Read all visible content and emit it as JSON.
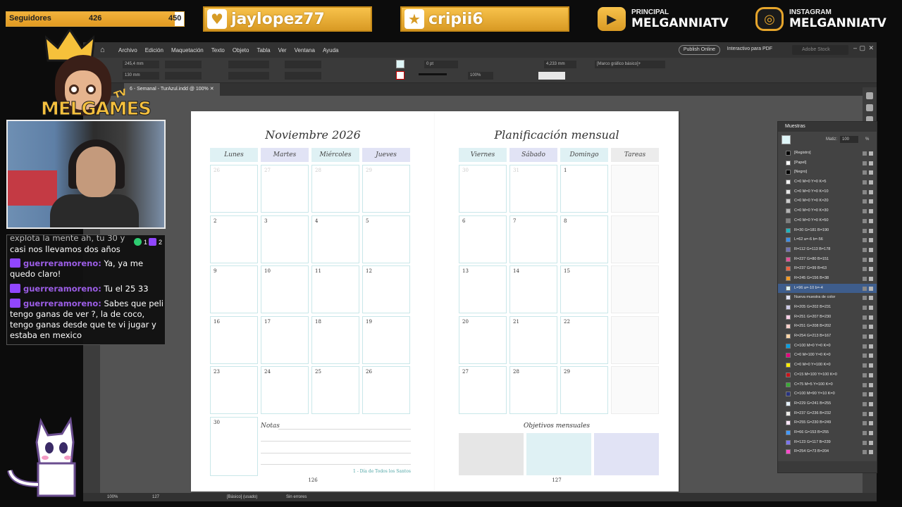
{
  "stream": {
    "followers": {
      "label": "Seguidores",
      "count": "426",
      "goal": "450",
      "progress": 0.9467
    },
    "socials": [
      {
        "icon": "heart-icon",
        "handle": "jaylopez77"
      },
      {
        "icon": "star-icon",
        "handle": "cripii6"
      }
    ],
    "brands": [
      {
        "icon": "youtube-icon",
        "line1": "PRINCIPAL",
        "line2": "MELGANNIATV"
      },
      {
        "icon": "instagram-icon",
        "line1": "INSTAGRAM",
        "line2": "MELGANNIATV"
      }
    ],
    "logo_text": "MELGAMES",
    "logo_badge": "TV"
  },
  "chat": {
    "counts": {
      "a": "1",
      "b": "2"
    },
    "messages": [
      {
        "partial": "explota la mente ah, tu 30 y"
      },
      {
        "partial": "casi nos llevamos dos años"
      },
      {
        "user": "guerreramoreno:",
        "text": "Ya, ya me quedo claro!"
      },
      {
        "user": "guerreramoreno:",
        "text": "Tu el 25 33"
      },
      {
        "user": "guerreramoreno:",
        "text": "Sabes que peli tengo ganas de ver ?, la de coco, tengo ganas desde que te vi jugar y estaba en mexico"
      }
    ]
  },
  "app": {
    "menu": [
      "Archivo",
      "Edición",
      "Maquetación",
      "Texto",
      "Objeto",
      "Tabla",
      "Ver",
      "Ventana",
      "Ayuda"
    ],
    "publish": "Publish Online",
    "interactive": "Interactivo para PDF",
    "stock_placeholder": "Adobe Stock",
    "tab": "6 - Semanal - TurAzul.indd @ 100%",
    "controls": {
      "x": "245,4 mm",
      "y": "130 mm",
      "stroke": "0 pt",
      "zoom": "100%",
      "measure": "4,233 mm",
      "frame_style": "[Marco gráfico básico]+"
    },
    "status": {
      "zoom": "100%",
      "page": "127",
      "style": "[Básico] (usado)",
      "errors": "Sin errores"
    }
  },
  "spread": {
    "left": {
      "title": "Noviembre 2026",
      "days": [
        "Lunes",
        "Martes",
        "Miércoles",
        "Jueves"
      ],
      "weeks": [
        [
          "26",
          "27",
          "28",
          "29"
        ],
        [
          "2",
          "3",
          "4",
          "5"
        ],
        [
          "9",
          "10",
          "11",
          "12"
        ],
        [
          "16",
          "17",
          "18",
          "19"
        ],
        [
          "23",
          "24",
          "25",
          "26"
        ],
        [
          "30"
        ]
      ],
      "notes_label": "Notas",
      "holiday": "1 - Día de Todos los Santos",
      "page_number": "126"
    },
    "right": {
      "title": "Planificación mensual",
      "days": [
        "Viernes",
        "Sábado",
        "Domingo",
        "Tareas"
      ],
      "weeks": [
        [
          "30",
          "31",
          "1"
        ],
        [
          "6",
          "7",
          "8"
        ],
        [
          "13",
          "14",
          "15"
        ],
        [
          "20",
          "21",
          "22"
        ],
        [
          "27",
          "28",
          "29"
        ]
      ],
      "goals_label": "Objetivos mensuales",
      "page_number": "127"
    },
    "colors": {
      "header1": "#dff1f4",
      "header2": "#e1e3f5",
      "goal1": "#e6e6e6",
      "goal2": "#dff1f4",
      "goal3": "#e1e3f5",
      "cell_border": "#c9e7e9"
    }
  },
  "swatches": {
    "title": "Muestras",
    "tint_label": "Matiz:",
    "tint_value": "100",
    "tint_unit": "%",
    "items": [
      {
        "name": "[Registro]",
        "color": "#000000"
      },
      {
        "name": "[Papel]",
        "color": "#ffffff"
      },
      {
        "name": "[Negro]",
        "color": "#000000"
      },
      {
        "name": "C=0 M=0 Y=0 K=5",
        "color": "#f2f2f2"
      },
      {
        "name": "C=0 M=0 Y=0 K=10",
        "color": "#e6e6e6"
      },
      {
        "name": "C=0 M=0 Y=0 K=20",
        "color": "#cccccc"
      },
      {
        "name": "C=0 M=0 Y=0 K=30",
        "color": "#b3b3b3"
      },
      {
        "name": "C=0 M=0 Y=0 K=50",
        "color": "#808080"
      },
      {
        "name": "R=30 G=181 B=190",
        "color": "#1eb5be"
      },
      {
        "name": "L=62 a=-6 b=-56",
        "color": "#3a8ee6"
      },
      {
        "name": "R=112 G=113 B=178",
        "color": "#7071b2"
      },
      {
        "name": "R=227 G=80 B=151",
        "color": "#e35097"
      },
      {
        "name": "R=237 G=99 B=63",
        "color": "#ed633f"
      },
      {
        "name": "R=245 G=156 B=38",
        "color": "#f59c26"
      },
      {
        "name": "L=96 a=-10 b=-4",
        "color": "#def5f7",
        "selected": true
      },
      {
        "name": "Nueva muestra de color",
        "color": "#e1e3f5"
      },
      {
        "name": "R=205 G=202 B=231",
        "color": "#cdcae7"
      },
      {
        "name": "R=251 G=207 B=230",
        "color": "#fbcfe6"
      },
      {
        "name": "R=251 G=208 B=202",
        "color": "#fbd0ca"
      },
      {
        "name": "R=254 G=213 B=167",
        "color": "#fed5a7"
      },
      {
        "name": "C=100 M=0 Y=0 K=0",
        "color": "#00a0e3"
      },
      {
        "name": "C=0 M=100 Y=0 K=0",
        "color": "#e5007e"
      },
      {
        "name": "C=0 M=0 Y=100 K=0",
        "color": "#ffed00"
      },
      {
        "name": "C=15 M=100 Y=100 K=0",
        "color": "#c8141b"
      },
      {
        "name": "C=75 M=5 Y=100 K=0",
        "color": "#3aa935"
      },
      {
        "name": "C=100 M=90 Y=10 K=0",
        "color": "#283380"
      },
      {
        "name": "R=229 G=241 B=255",
        "color": "#e5f1ff"
      },
      {
        "name": "R=237 G=236 B=232",
        "color": "#edece8"
      },
      {
        "name": "R=255 G=230 B=249",
        "color": "#ffe6f9"
      },
      {
        "name": "R=66 G=153 B=255",
        "color": "#4299ff"
      },
      {
        "name": "R=123 G=117 B=239",
        "color": "#7b75ef"
      },
      {
        "name": "R=254 G=73 B=204",
        "color": "#fe49cc"
      }
    ]
  }
}
